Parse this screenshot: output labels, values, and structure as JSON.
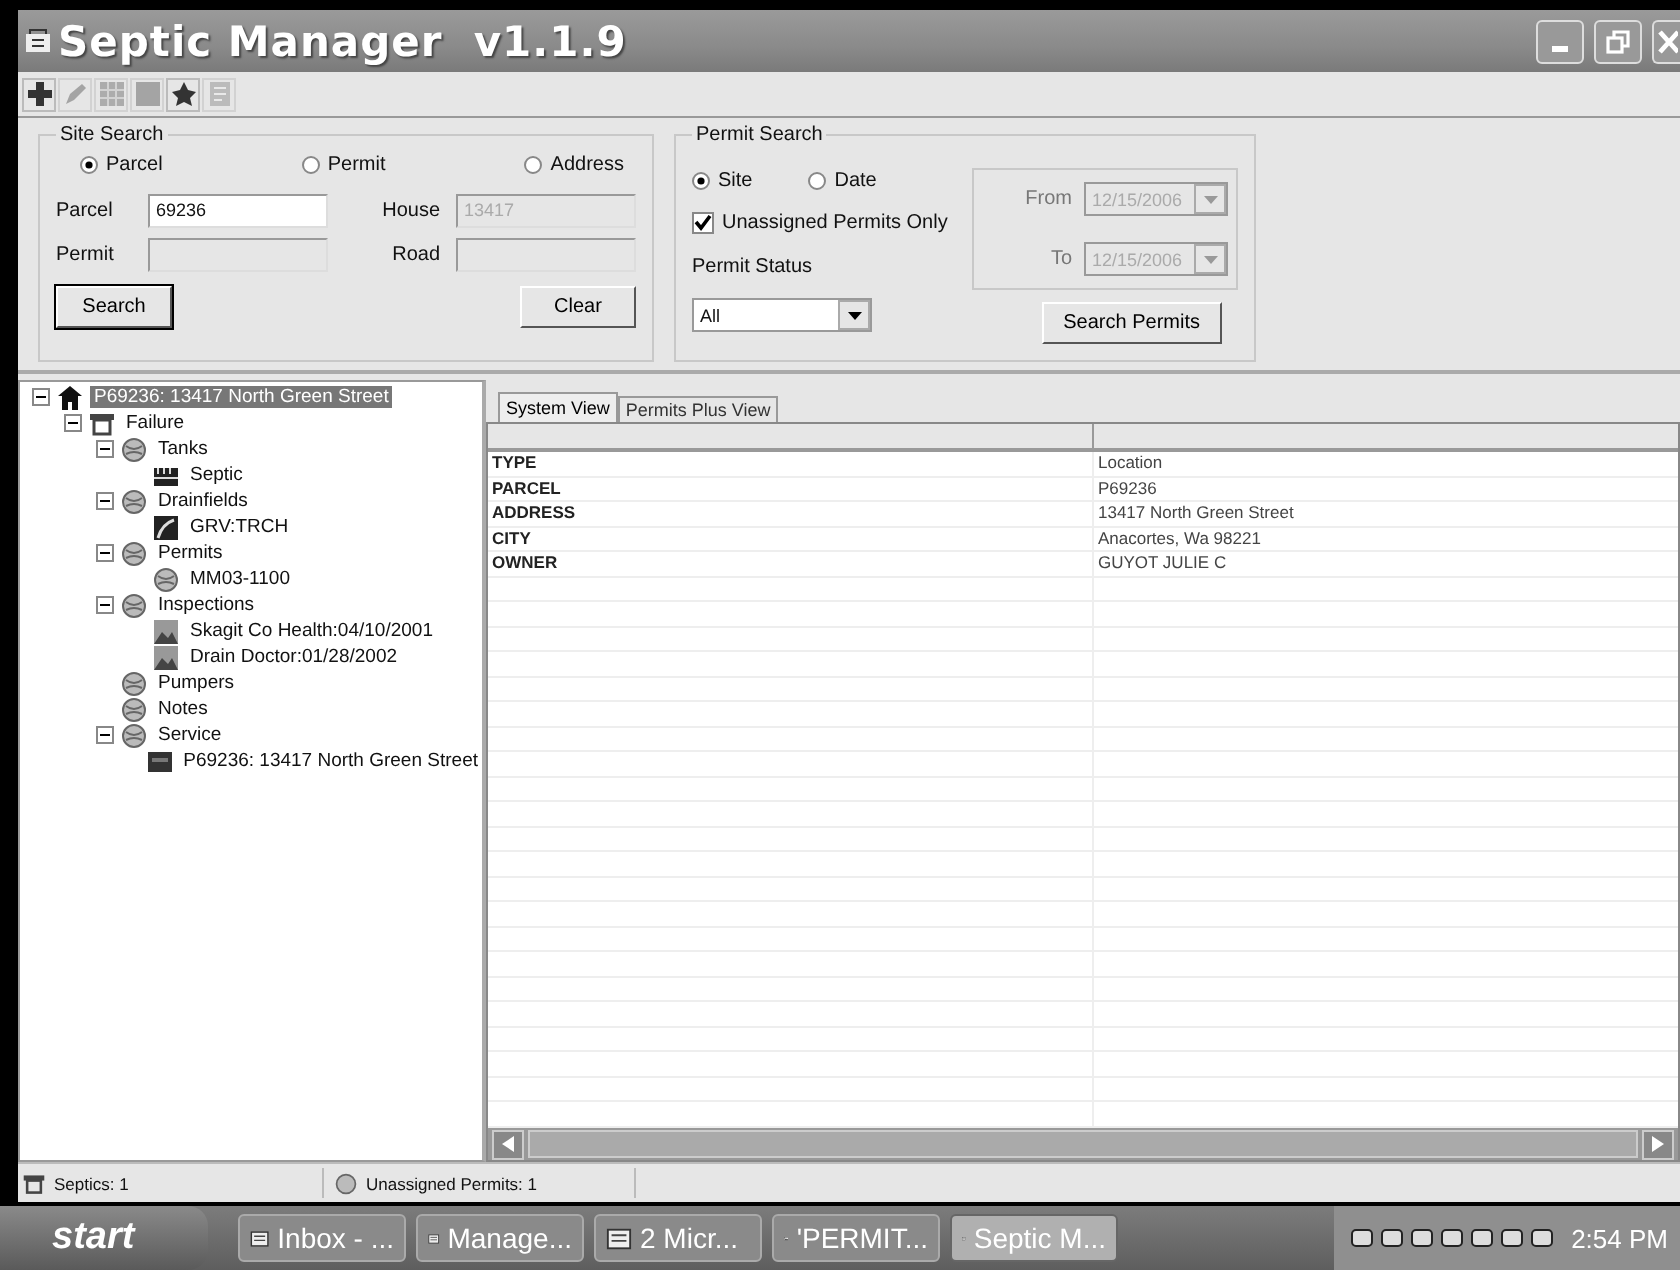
{
  "window": {
    "title": "Septic Manager  v1.1.9"
  },
  "toolbar": {
    "buttons": [
      {
        "kind": "add",
        "disabled": false
      },
      {
        "kind": "edit",
        "disabled": true
      },
      {
        "kind": "grid",
        "disabled": true
      },
      {
        "kind": "block",
        "disabled": true
      },
      {
        "kind": "star",
        "disabled": false
      },
      {
        "kind": "report",
        "disabled": true
      }
    ]
  },
  "site_search": {
    "title": "Site Search",
    "modes": [
      {
        "label": "Parcel",
        "selected": true
      },
      {
        "label": "Permit",
        "selected": false
      },
      {
        "label": "Address",
        "selected": false
      }
    ],
    "fields": [
      {
        "label": "Parcel",
        "value": "69236",
        "disabled": false
      },
      {
        "label": "House",
        "value": "13417",
        "disabled": true
      },
      {
        "label": "Permit",
        "disabled": true
      },
      {
        "label": "Road",
        "disabled": true
      }
    ],
    "buttons": [
      "Search",
      "Clear"
    ]
  },
  "permit_search": {
    "title": "Permit Search",
    "modes": [
      {
        "label": "Site",
        "selected": true
      },
      {
        "label": "Date",
        "selected": false
      }
    ],
    "unassigned_only": {
      "label": "Unassigned Permits Only",
      "checked": true
    },
    "status": {
      "label": "Permit Status",
      "value": "All"
    },
    "dates": [
      {
        "label": "From",
        "value": "12/15/2006",
        "disabled": true
      },
      {
        "label": "To",
        "value": "12/15/2006",
        "disabled": true
      }
    ],
    "button": "Search Permits"
  },
  "tree": [
    {
      "label": "P69236: 13417 North Green Street",
      "kind": "site",
      "selected": true,
      "expanded": true,
      "children": [
        {
          "label": "Failure",
          "kind": "system",
          "selected": false,
          "expanded": true,
          "children": [
            {
              "label": "Tanks",
              "kind": "folder",
              "selected": false,
              "expanded": true,
              "children": [
                {
                  "label": "Septic",
                  "kind": "tank",
                  "selected": false
                }
              ]
            },
            {
              "label": "Drainfields",
              "kind": "folder",
              "selected": false,
              "expanded": true,
              "children": [
                {
                  "label": "GRV:TRCH",
                  "kind": "drainfield",
                  "selected": false
                }
              ]
            },
            {
              "label": "Permits",
              "kind": "folder",
              "selected": false,
              "expanded": true,
              "children": [
                {
                  "label": "MM03-1100",
                  "kind": "permit",
                  "selected": false
                }
              ]
            },
            {
              "label": "Inspections",
              "kind": "folder",
              "selected": false,
              "expanded": true,
              "children": [
                {
                  "label": "Skagit Co Health:04/10/2001",
                  "kind": "inspection",
                  "selected": false
                },
                {
                  "label": "Drain Doctor:01/28/2002",
                  "kind": "inspection",
                  "selected": false
                }
              ]
            },
            {
              "label": "Pumpers",
              "kind": "folder",
              "selected": false
            },
            {
              "label": "Notes",
              "kind": "folder",
              "selected": false
            },
            {
              "label": "Service",
              "kind": "folder",
              "selected": false,
              "expanded": true,
              "children": [
                {
                  "label": "P69236: 13417 North Green Street",
                  "kind": "service",
                  "selected": false
                }
              ]
            }
          ]
        }
      ]
    }
  ],
  "tabs": [
    {
      "label": "System View",
      "selected": true
    },
    {
      "label": "Permits Plus View",
      "selected": false
    }
  ],
  "table": {
    "rows": [
      {
        "field": "TYPE",
        "value": "Location"
      },
      {
        "field": "PARCEL",
        "value": "P69236"
      },
      {
        "field": "ADDRESS",
        "value": "13417 North Green Street"
      },
      {
        "field": "CITY",
        "value": "Anacortes, Wa 98221"
      },
      {
        "field": "OWNER",
        "value": "GUYOT JULIE C"
      }
    ]
  },
  "status_bar": [
    "Septics: 1",
    "Unassigned Permits: 1"
  ],
  "taskbar": {
    "start": "start",
    "buttons": [
      {
        "label": "Inbox - ...",
        "kind": "mail",
        "selected": false
      },
      {
        "label": "Manage...",
        "kind": "folder",
        "selected": false
      },
      {
        "label": "2 Micr...",
        "kind": "word",
        "selected": false
      },
      {
        "label": "'PERMIT...",
        "kind": "image",
        "selected": false
      },
      {
        "label": "Septic M...",
        "kind": "app",
        "selected": true
      }
    ],
    "clock": "2:54 PM"
  }
}
